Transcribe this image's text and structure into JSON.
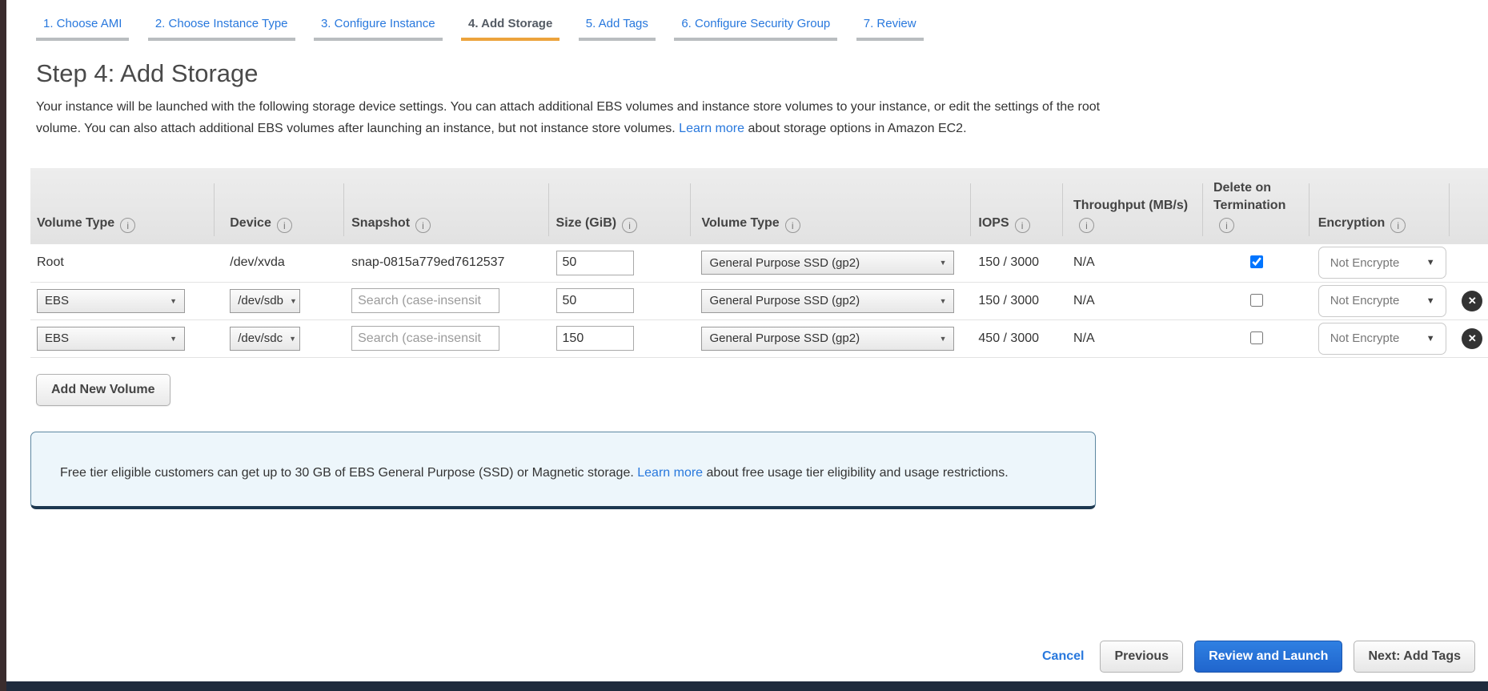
{
  "tabs": [
    {
      "label": "1. Choose AMI",
      "active": false
    },
    {
      "label": "2. Choose Instance Type",
      "active": false
    },
    {
      "label": "3. Configure Instance",
      "active": false
    },
    {
      "label": "4. Add Storage",
      "active": true
    },
    {
      "label": "5. Add Tags",
      "active": false
    },
    {
      "label": "6. Configure Security Group",
      "active": false
    },
    {
      "label": "7. Review",
      "active": false
    }
  ],
  "header": {
    "title": "Step 4: Add Storage",
    "description_before_link": "Your instance will be launched with the following storage device settings. You can attach additional EBS volumes and instance store volumes to your instance, or edit the settings of the root volume. You can also attach additional EBS volumes after launching an instance, but not instance store volumes.",
    "learn_more_label": "Learn more",
    "description_after_link": "about storage options in Amazon EC2."
  },
  "table": {
    "headers": [
      "Volume Type",
      "Device",
      "Snapshot",
      "Size (GiB)",
      "Volume Type",
      "IOPS",
      "Throughput (MB/s)",
      "Delete on Termination",
      "Encryption"
    ],
    "rows": [
      {
        "volume_type": "Root",
        "device": "/dev/xvda",
        "snapshot": "snap-0815a779ed7612537",
        "size": "50",
        "type_select": "General Purpose SSD (gp2)",
        "iops": "150 / 3000",
        "throughput": "N/A",
        "delete_on_termination": true,
        "encryption": "Not Encrypte"
      },
      {
        "volume_type": "EBS",
        "device": "/dev/sdb",
        "snapshot_placeholder": "Search (case-insensit",
        "size": "50",
        "type_select": "General Purpose SSD (gp2)",
        "iops": "150 / 3000",
        "throughput": "N/A",
        "delete_on_termination": false,
        "encryption": "Not Encrypte"
      },
      {
        "volume_type": "EBS",
        "device": "/dev/sdc",
        "snapshot_placeholder": "Search (case-insensit",
        "size": "150",
        "type_select": "General Purpose SSD (gp2)",
        "iops": "450 / 3000",
        "throughput": "N/A",
        "delete_on_termination": false,
        "encryption": "Not Encrypte"
      }
    ]
  },
  "buttons": {
    "add_new_volume": "Add New Volume"
  },
  "free_tier": {
    "text_before": "Free tier eligible customers can get up to 30 GB of EBS General Purpose (SSD) or Magnetic storage.",
    "learn_more_label": "Learn more",
    "text_after": "about free usage tier eligibility and usage restrictions."
  },
  "footer": {
    "cancel": "Cancel",
    "previous": "Previous",
    "review_and_launch": "Review and Launch",
    "next_add_tags": "Next: Add Tags"
  },
  "icons": {
    "info": "i",
    "select_caret": "▼",
    "dropdown_caret": "▼",
    "delete_x": "✕"
  },
  "colors": {
    "accent_orange": "#eca33c",
    "link_blue": "#2878dd",
    "primary_button_blue": "#2065cd",
    "left_strip": "#3a2c2d",
    "bottom_bar": "#1f2b3d"
  }
}
